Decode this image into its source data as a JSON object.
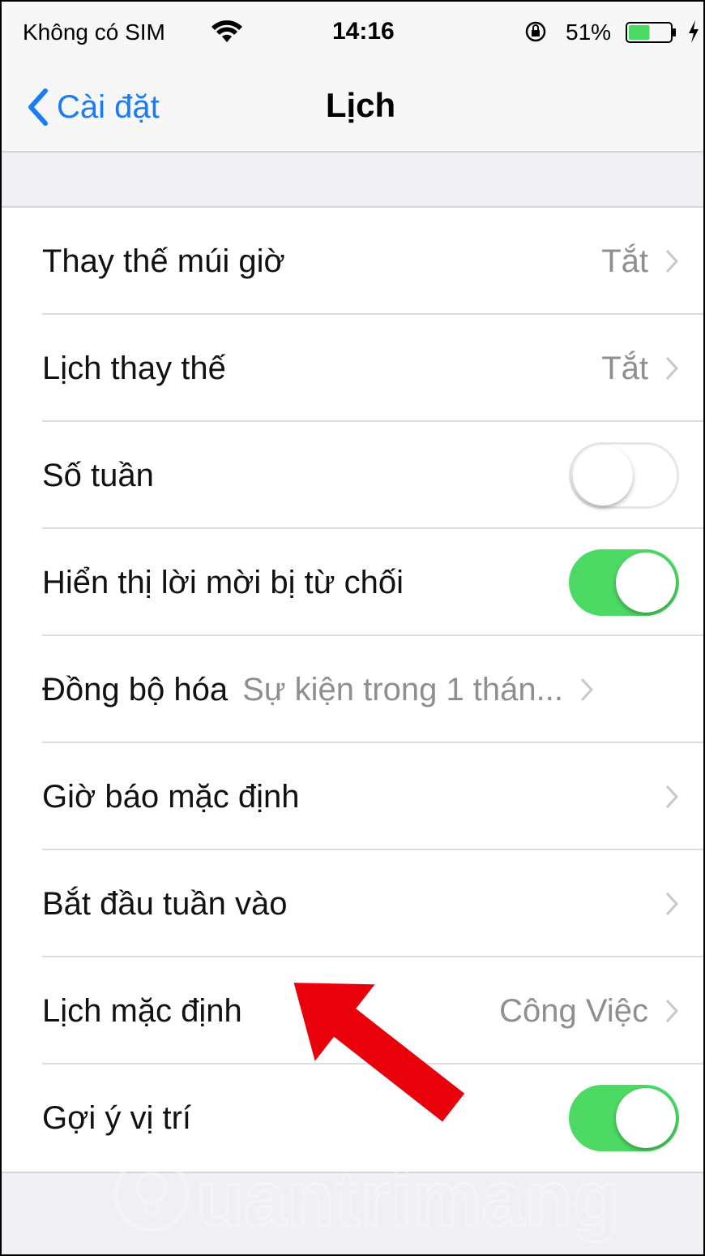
{
  "status_bar": {
    "carrier": "Không có SIM",
    "time": "14:16",
    "battery_percent": "51%",
    "battery_level": 0.51,
    "icons": [
      "wifi-icon",
      "orientation-lock-icon",
      "battery-icon",
      "charging-bolt-icon"
    ]
  },
  "nav": {
    "back_label": "Cài đặt",
    "title": "Lịch"
  },
  "rows": [
    {
      "label": "Thay thế múi giờ",
      "value": "Tắt",
      "type": "disclosure"
    },
    {
      "label": "Lịch thay thế",
      "value": "Tắt",
      "type": "disclosure"
    },
    {
      "label": "Số tuần",
      "type": "toggle",
      "on": false
    },
    {
      "label": "Hiển thị lời mời bị từ chối",
      "type": "toggle",
      "on": true
    },
    {
      "label": "Đồng bộ hóa",
      "value": "Sự kiện trong 1 thán...",
      "type": "disclosure"
    },
    {
      "label": "Giờ báo mặc định",
      "type": "disclosure"
    },
    {
      "label": "Bắt đầu tuần vào",
      "type": "disclosure"
    },
    {
      "label": "Lịch mặc định",
      "value": "Công Việc",
      "type": "disclosure"
    },
    {
      "label": "Gợi ý vị trí",
      "type": "toggle",
      "on": true
    }
  ],
  "colors": {
    "accent": "#1a7cf5",
    "toggle_on": "#4cd964",
    "annotation_arrow": "#e8000b"
  },
  "watermark": "Quantrimang"
}
